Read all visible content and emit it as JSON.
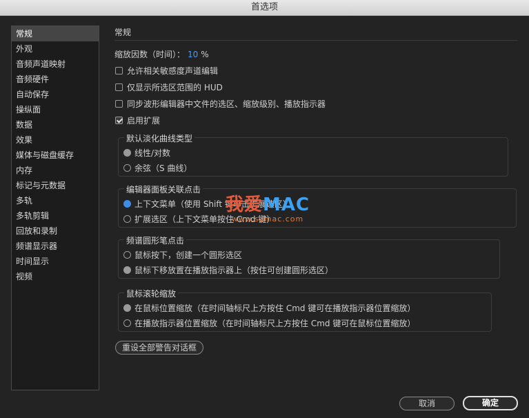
{
  "window": {
    "title": "首选项"
  },
  "sidebar": {
    "items": [
      {
        "label": "常规",
        "selected": true
      },
      {
        "label": "外观"
      },
      {
        "label": "音频声道映射"
      },
      {
        "label": "音频硬件"
      },
      {
        "label": "自动保存"
      },
      {
        "label": "操纵面"
      },
      {
        "label": "数据"
      },
      {
        "label": "效果"
      },
      {
        "label": "媒体与磁盘缓存"
      },
      {
        "label": "内存"
      },
      {
        "label": "标记与元数据"
      },
      {
        "label": "多轨"
      },
      {
        "label": "多轨剪辑"
      },
      {
        "label": "回放和录制"
      },
      {
        "label": "频谱显示器"
      },
      {
        "label": "时间显示"
      },
      {
        "label": "视频"
      }
    ]
  },
  "main": {
    "title": "常规",
    "zoom": {
      "label": "缩放因数（时间）：",
      "value": "10",
      "unit": "%"
    },
    "checkboxes": [
      {
        "label": "允许相关敏感度声道编辑",
        "checked": false
      },
      {
        "label": "仅显示所选区范围的 HUD",
        "checked": false
      },
      {
        "label": "同步波形编辑器中文件的选区、缩放级别、播放指示器",
        "checked": false
      },
      {
        "label": "启用扩展",
        "checked": true
      }
    ],
    "fade_group": {
      "title": "默认淡化曲线类型",
      "options": [
        {
          "label": "线性/对数",
          "state": "disabled-selected"
        },
        {
          "label": "余弦（S 曲线）",
          "state": "off"
        }
      ]
    },
    "editor_group": {
      "title": "编辑器面板关联点击",
      "options": [
        {
          "label": "上下文菜单（使用 Shift 键单击扩展选区）",
          "state": "on"
        },
        {
          "label": "扩展选区（上下文菜单按住 Cmd 键）",
          "state": "off"
        }
      ]
    },
    "spectral_group": {
      "title": "频谱圆形笔点击",
      "options": [
        {
          "label": "鼠标按下，创建一个圆形选区",
          "state": "off"
        },
        {
          "label": "鼠标下移放置在播放指示器上（按住可创建圆形选区）",
          "state": "disabled-selected"
        }
      ]
    },
    "wheel_group": {
      "title": "鼠标滚轮缩放",
      "options": [
        {
          "label": "在鼠标位置缩放（在时间轴标尺上方按住 Cmd 键可在播放指示器位置缩放）",
          "state": "disabled-selected"
        },
        {
          "label": "在播放指示器位置缩放（在时间轴标尺上方按住 Cmd 键可在鼠标位置缩放）",
          "state": "off"
        }
      ]
    },
    "reset_button": "重设全部警告对话框"
  },
  "footer": {
    "cancel": "取消",
    "ok": "确定"
  },
  "watermark": {
    "cn": "我爱",
    "en": "MAC",
    "url": "www.szmac.com"
  },
  "colors": {
    "accent": "#3f8ce6",
    "background": "#232323"
  }
}
